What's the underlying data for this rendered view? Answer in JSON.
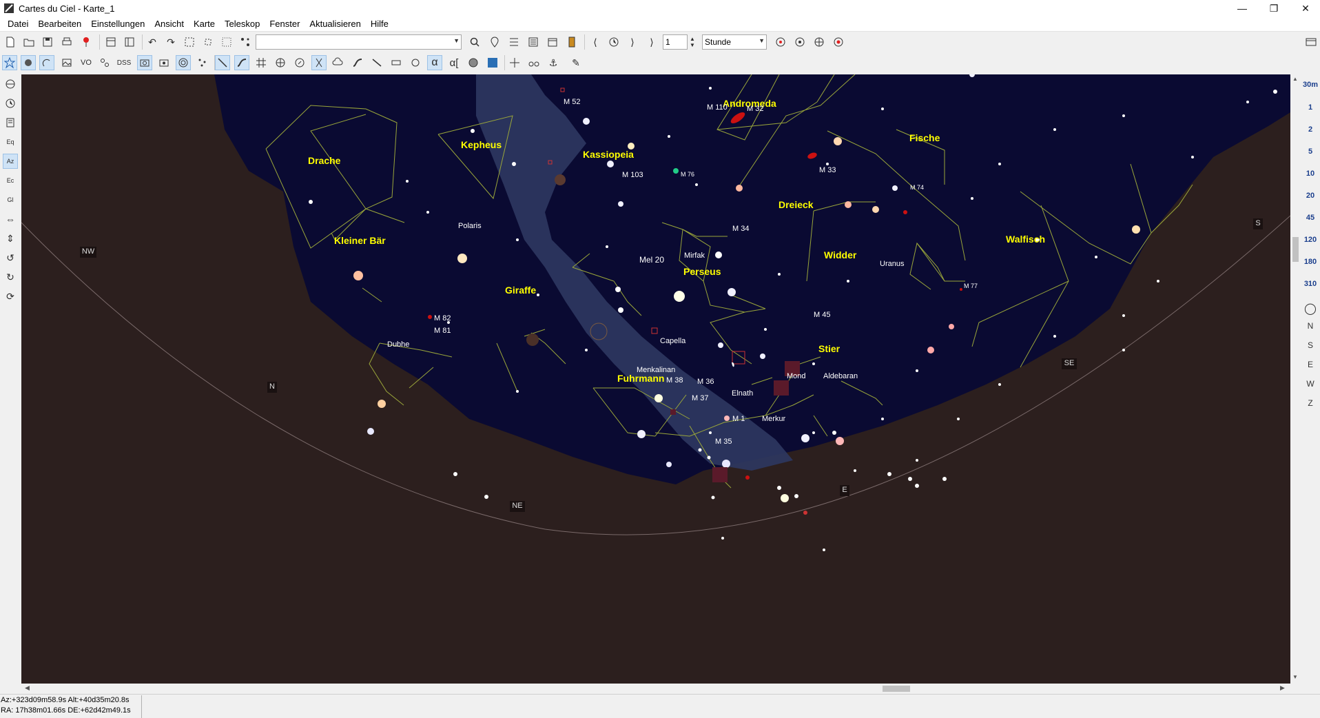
{
  "window": {
    "title": "Cartes du Ciel - Karte_1",
    "controls": [
      "minimize-icon",
      "restore-icon",
      "close-icon"
    ]
  },
  "menu": [
    "Datei",
    "Bearbeiten",
    "Einstellungen",
    "Ansicht",
    "Karte",
    "Teleskop",
    "Fenster",
    "Aktualisieren",
    "Hilfe"
  ],
  "toolbar": {
    "search_value": "",
    "step_value": "1",
    "unit_value": "Stunde"
  },
  "toolbar2": {
    "vo_label": "VO",
    "dss_label": "DSS"
  },
  "fov_buttons": [
    "30m",
    "1",
    "2",
    "5",
    "10",
    "20",
    "45",
    "120",
    "180",
    "310"
  ],
  "direction_buttons": [
    "N",
    "S",
    "E",
    "W",
    "Z"
  ],
  "status": {
    "altaz": "Az:+323d09m58.9s Alt:+40d35m20.8s",
    "radec": "RA: 17h38m01.66s DE:+62d42m49.1s"
  },
  "sky": {
    "constellations": [
      "Andromeda",
      "Kepheus",
      "Kassiopeia",
      "Fische",
      "Drache",
      "Dreieck",
      "Kleiner Bär",
      "Widder",
      "Walfisch",
      "Perseus",
      "Giraffe",
      "Stier",
      "Fuhrmann"
    ],
    "objects": [
      "M 52",
      "M 110",
      "M 32",
      "M 33",
      "M 74",
      "M 103",
      "M 76",
      "M 34",
      "Polaris",
      "Mel 20",
      "Mirfak",
      "Uranus",
      "M 77",
      "M 45",
      "M 82",
      "M 81",
      "Capella",
      "Dubhe",
      "Menkalinan",
      "Mond",
      "Aldebaran",
      "M 38",
      "M 36",
      "Elnath",
      "M 37",
      "M 1",
      "Merkur",
      "M 35"
    ],
    "horizon_markers": [
      "NW",
      "N",
      "NE",
      "E",
      "SE",
      "S"
    ]
  },
  "colors": {
    "sky_background": "#0a0a32",
    "ground": "#2c1f1e",
    "milky_way": "#2e3760",
    "constellation_line": "#9aa63a",
    "constellation_label": "#ffff00"
  }
}
